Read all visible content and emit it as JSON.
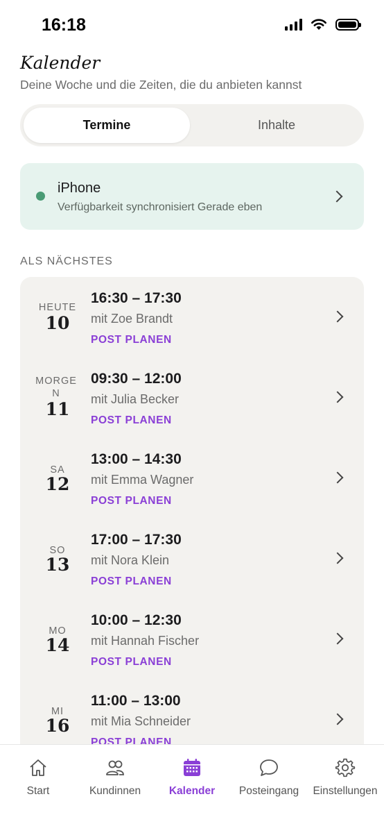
{
  "status_bar": {
    "time": "16:18"
  },
  "header": {
    "title": "Kalender",
    "subtitle": "Deine Woche und die Zeiten, die du anbieten kannst"
  },
  "segments": {
    "active": "Termine",
    "inactive": "Inhalte"
  },
  "sync_card": {
    "title": "iPhone",
    "subtitle": "Verfügbarkeit synchronisiert Gerade eben",
    "status_color": "#4a9b75"
  },
  "section_label": "ALS NÄCHSTES",
  "appointments": [
    {
      "day": "HEUTE",
      "date": "10",
      "time": "16:30 – 17:30",
      "with": "mit Zoe Brandt",
      "action": "POST PLANEN"
    },
    {
      "day": "MORGEN",
      "date": "11",
      "time": "09:30 – 12:00",
      "with": "mit Julia Becker",
      "action": "POST PLANEN"
    },
    {
      "day": "SA",
      "date": "12",
      "time": "13:00 – 14:30",
      "with": "mit Emma Wagner",
      "action": "POST PLANEN"
    },
    {
      "day": "SO",
      "date": "13",
      "time": "17:00 – 17:30",
      "with": "mit Nora Klein",
      "action": "POST PLANEN"
    },
    {
      "day": "MO",
      "date": "14",
      "time": "10:00 – 12:30",
      "with": "mit Hannah Fischer",
      "action": "POST PLANEN"
    },
    {
      "day": "MI",
      "date": "16",
      "time": "11:00 – 13:00",
      "with": "mit Mia Schneider",
      "action": "POST PLANEN"
    }
  ],
  "tabbar": {
    "items": [
      {
        "label": "Start",
        "icon": "home-icon"
      },
      {
        "label": "Kundinnen",
        "icon": "people-icon"
      },
      {
        "label": "Kalender",
        "icon": "calendar-icon",
        "active": true
      },
      {
        "label": "Posteingang",
        "icon": "chat-bubble-icon"
      },
      {
        "label": "Einstellungen",
        "icon": "gear-icon"
      }
    ]
  },
  "colors": {
    "accent": "#8a3fd6",
    "sync_card_bg": "#e6f3ee",
    "list_bg": "#f3f2ef",
    "segment_bg": "#f2f1ee"
  }
}
